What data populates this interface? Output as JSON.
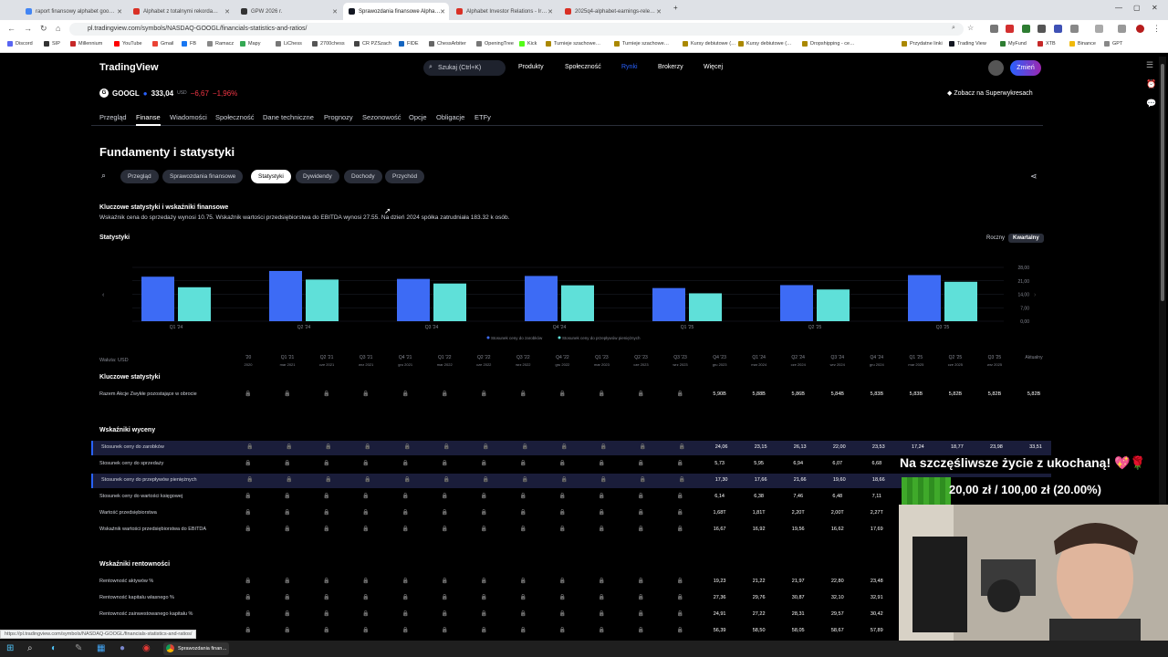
{
  "browser": {
    "tabs": [
      {
        "label": "raport finansowy alphabet goo…",
        "color": "#4285f4"
      },
      {
        "label": "Alphabet z totalnymi rekorda…",
        "color": "#d93025"
      },
      {
        "label": "GPW 2026 r.",
        "color": "#333333"
      },
      {
        "label": "Sprawozdania finansowe Alpha…",
        "color": "#131722"
      },
      {
        "label": "Alphabet Investor Relations - Ir…",
        "color": "#d93025"
      },
      {
        "label": "2025q4-alphabet-earnings-rele…",
        "color": "#d93025"
      }
    ],
    "url": "pl.tradingview.com/symbols/NASDAQ-GOOGL/financials-statistics-and-ratios/",
    "bookmarks": [
      "Discord",
      "SIP",
      "Millennium",
      "YouTube",
      "Gmail",
      "FB",
      "Ramacz",
      "Mapy",
      "LiChess",
      "2700chess",
      "CR PZSzach",
      "FIDE",
      "ChessArbiter",
      "OpeningTree",
      "Kick",
      "Turnieje szachowe…",
      "Turnieje szachowe…",
      "Kursy debiutowe (…",
      "Kursy debiutowe (…",
      "Dropshipping - ce…",
      "Przydatne linki",
      "Trading View",
      "MyFund",
      "XTB",
      "Binance",
      "GPT"
    ],
    "status_link": "https://pl.tradingview.com/symbols/NASDAQ-GOOGL/financials-statistics-and-ratios/"
  },
  "header": {
    "logo": "TradingView",
    "search_placeholder": "Szukaj (Ctrl+K)",
    "nav": [
      "Produkty",
      "Społeczność",
      "Rynki",
      "Brokerzy",
      "Więcej"
    ],
    "cta": "Zmień",
    "superwyk": "Zobacz na Superwykresach"
  },
  "ticker": {
    "symbol": "GOOGL",
    "price": "333,04",
    "currency": "USD",
    "change": "−6,67",
    "change_pct": "−1,96%"
  },
  "subnav": [
    "Przegląd",
    "Finanse",
    "Wiadomości",
    "Społeczność",
    "Dane techniczne",
    "Prognozy",
    "Sezonowość",
    "Opcje",
    "Obligacje",
    "ETFy"
  ],
  "page_title": "Fundamenty i statystyki",
  "pills": [
    "Przegląd",
    "Sprawozdania finansowe",
    "Statystyki",
    "Dywidendy",
    "Dochody",
    "Przychód"
  ],
  "summary": {
    "title": "Kluczowe statystyki i wskaźniki finansowe",
    "text": "Wskaźnik cena do sprzedaży wynosi 10.75. Wskaźnik wartości przedsiębiorstwa do EBITDA wynosi 27.55. Na dzień 2024 spółka zatrudniała 183.32 k osób."
  },
  "stats_label": "Statystyki",
  "period_toggle": {
    "annual": "Roczny",
    "quarterly": "Kwartalny"
  },
  "chart_data": {
    "type": "bar",
    "categories": [
      "Q1 '24",
      "Q2 '24",
      "Q3 '24",
      "Q4 '24",
      "Q1 '25",
      "Q2 '25",
      "Q3 '25"
    ],
    "series": [
      {
        "name": "Stosunek ceny do zarobków",
        "color": "#3d6bf5",
        "values": [
          23.15,
          26.13,
          22.0,
          23.53,
          17.24,
          18.77,
          23.98
        ]
      },
      {
        "name": "Stosunek ceny do przepływów pieniężnych",
        "color": "#5fe0d9",
        "values": [
          17.66,
          21.66,
          19.6,
          18.66,
          14.5,
          16.5,
          20.5
        ]
      }
    ],
    "yticks": [
      "0,00",
      "7,00",
      "14,00",
      "21,00",
      "28,00"
    ],
    "ylim": [
      0,
      28
    ],
    "legend": "bottom"
  },
  "table": {
    "currency_label": "Waluta: USD",
    "columns": [
      [
        "'20",
        "2020"
      ],
      [
        "Q1 '21",
        "mar 2021"
      ],
      [
        "Q2 '21",
        "cze 2021"
      ],
      [
        "Q3 '21",
        "wrz 2021"
      ],
      [
        "Q4 '21",
        "gru 2021"
      ],
      [
        "Q1 '22",
        "mar 2022"
      ],
      [
        "Q2 '22",
        "cze 2022"
      ],
      [
        "Q3 '22",
        "wrz 2022"
      ],
      [
        "Q4 '22",
        "gru 2022"
      ],
      [
        "Q1 '23",
        "mar 2023"
      ],
      [
        "Q2 '23",
        "cze 2023"
      ],
      [
        "Q3 '23",
        "wrz 2023"
      ],
      [
        "Q4 '23",
        "gru 2023"
      ],
      [
        "Q1 '24",
        "mar 2024"
      ],
      [
        "Q2 '24",
        "cze 2024"
      ],
      [
        "Q3 '24",
        "wrz 2024"
      ],
      [
        "Q4 '24",
        "gru 2024"
      ],
      [
        "Q1 '25",
        "mar 2025"
      ],
      [
        "Q2 '25",
        "cze 2025"
      ],
      [
        "Q3 '25",
        "wrz 2025"
      ],
      [
        "Aktualny",
        ""
      ]
    ],
    "sections": [
      {
        "title": "Kluczowe statystyki",
        "rows": [
          {
            "label": "Razem Akcje Zwykłe pozostające w obrocie",
            "values": [
              "5,90B",
              "5,88B",
              "5,86B",
              "5,84B",
              "5,83B",
              "5,83B",
              "5,82B",
              "5,82B",
              "5,82B"
            ],
            "hl": false
          }
        ]
      },
      {
        "title": "Wskaźniki wyceny",
        "rows": [
          {
            "label": "Stosunek ceny do zarobków",
            "values": [
              "24,06",
              "23,15",
              "26,13",
              "22,00",
              "23,53",
              "17,24",
              "18,77",
              "23,98",
              "33,51"
            ],
            "hl": true
          },
          {
            "label": "Stosunek ceny do sprzedaży",
            "values": [
              "5,73",
              "5,95",
              "6,94",
              "6,07",
              "6,68"
            ],
            "hl": false
          },
          {
            "label": "Stosunek ceny do przepływów pieniężnych",
            "values": [
              "17,30",
              "17,66",
              "21,66",
              "19,60",
              "18,66"
            ],
            "hl": true
          },
          {
            "label": "Stosunek ceny do wartości księgowej",
            "values": [
              "6,14",
              "6,38",
              "7,46",
              "6,48",
              "7,11"
            ],
            "hl": false
          },
          {
            "label": "Wartość przedsiębiorstwa",
            "values": [
              "1,68T",
              "1,81T",
              "2,20T",
              "2,00T",
              "2,27T"
            ],
            "hl": false
          },
          {
            "label": "Wskaźnik wartości przedsiębiorstwa do EBITDA",
            "values": [
              "16,67",
              "16,92",
              "19,56",
              "16,62",
              "17,69"
            ],
            "hl": false
          }
        ]
      },
      {
        "title": "Wskaźniki rentowności",
        "rows": [
          {
            "label": "Rentowność aktywów %",
            "values": [
              "19,23",
              "21,22",
              "21,97",
              "22,80",
              "23,48"
            ],
            "hl": false
          },
          {
            "label": "Rentowność kapitału własnego %",
            "values": [
              "27,36",
              "29,76",
              "30,87",
              "32,10",
              "32,91"
            ],
            "hl": false
          },
          {
            "label": "Rentowność zainwestowanego kapitału %",
            "values": [
              "24,91",
              "27,22",
              "28,31",
              "29,57",
              "30,42"
            ],
            "hl": false
          },
          {
            "label": "",
            "values": [
              "56,39",
              "58,50",
              "58,05",
              "58,67",
              "57,89"
            ],
            "hl": false
          }
        ]
      }
    ]
  },
  "donation": {
    "title": "Na szczęśliwsze życie z ukochaną! 💖🌹",
    "amount_text": "20,00 zł / 100,00 zł (20.00%)",
    "progress": 0.2
  },
  "taskbar": {
    "app_label": "Sprawozdania finan…"
  }
}
